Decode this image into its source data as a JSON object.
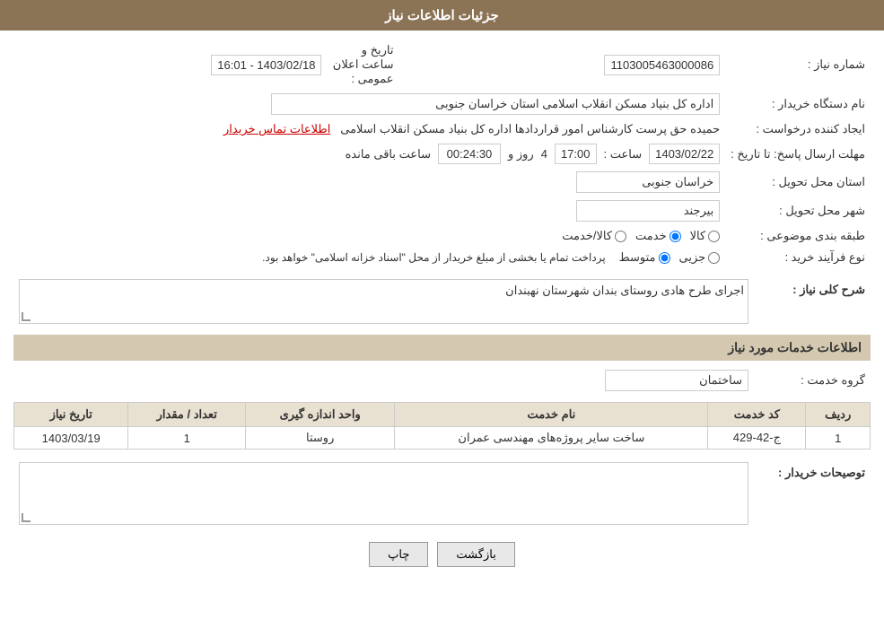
{
  "header": {
    "title": "جزئیات اطلاعات نیاز"
  },
  "fields": {
    "shomara_niaz_label": "شماره نیاز :",
    "shomara_niaz_value": "1103005463000086",
    "nam_dastgah_label": "نام دستگاه خریدار :",
    "nam_dastgah_value": "اداره کل بنیاد مسکن انقلاب اسلامی استان خراسان جنوبی",
    "ijad_konande_label": "ایجاد کننده درخواست :",
    "ijad_konande_value": "حمیده حق پرست کارشناس امور قراردادها اداره کل بنیاد مسکن انقلاب اسلامی",
    "ijad_konande_link": "اطلاعات تماس خریدار",
    "mohlat_label": "مهلت ارسال پاسخ: تا تاریخ :",
    "date_value": "1403/02/22",
    "time_label": "ساعت :",
    "time_value": "17:00",
    "roz_label": "روز و",
    "roz_value": "4",
    "countdown_value": "00:24:30",
    "countdown_label": "ساعت باقی مانده",
    "ostan_label": "استان محل تحویل :",
    "ostan_value": "خراسان جنوبی",
    "shahr_label": "شهر محل تحویل :",
    "shahr_value": "بیرجند",
    "tabaqe_label": "طبقه بندی موضوعی :",
    "radio_kala": "کالا",
    "radio_khedmat": "خدمت",
    "radio_kala_khedmat": "کالا/خدمت",
    "selected_radio": "khedmat",
    "nooe_farayand_label": "نوع فرآیند خرید :",
    "radio_jozi": "جزیی",
    "radio_motavasset": "متوسط",
    "nooe_note": "پرداخت تمام یا بخشی از مبلغ خریدار از محل \"اسناد خزانه اسلامی\" خواهد بود.",
    "sharh_label": "شرح کلی نیاز :",
    "sharh_value": "اجرای طرح هادی روستای بندان شهرستان نهبندان",
    "services_header": "اطلاعات خدمات مورد نیاز",
    "grohe_khedmat_label": "گروه خدمت :",
    "grohe_khedmat_value": "ساختمان",
    "table_headers": {
      "radif": "ردیف",
      "code_khedmat": "کد خدمت",
      "name_khedmat": "نام خدمت",
      "vahed": "واحد اندازه گیری",
      "tedad": "تعداد / مقدار",
      "tarikh": "تاریخ نیاز"
    },
    "table_rows": [
      {
        "radif": "1",
        "code": "ج-42-429",
        "name": "ساخت سایر پروژه‌های مهندسی عمران",
        "vahed": "روستا",
        "tedad": "1",
        "tarikh": "1403/03/19"
      }
    ],
    "toseeh_label": "توصیحات خریدار :",
    "toseeh_value": "",
    "btn_chap": "چاپ",
    "btn_bazgasht": "بازگشت"
  }
}
